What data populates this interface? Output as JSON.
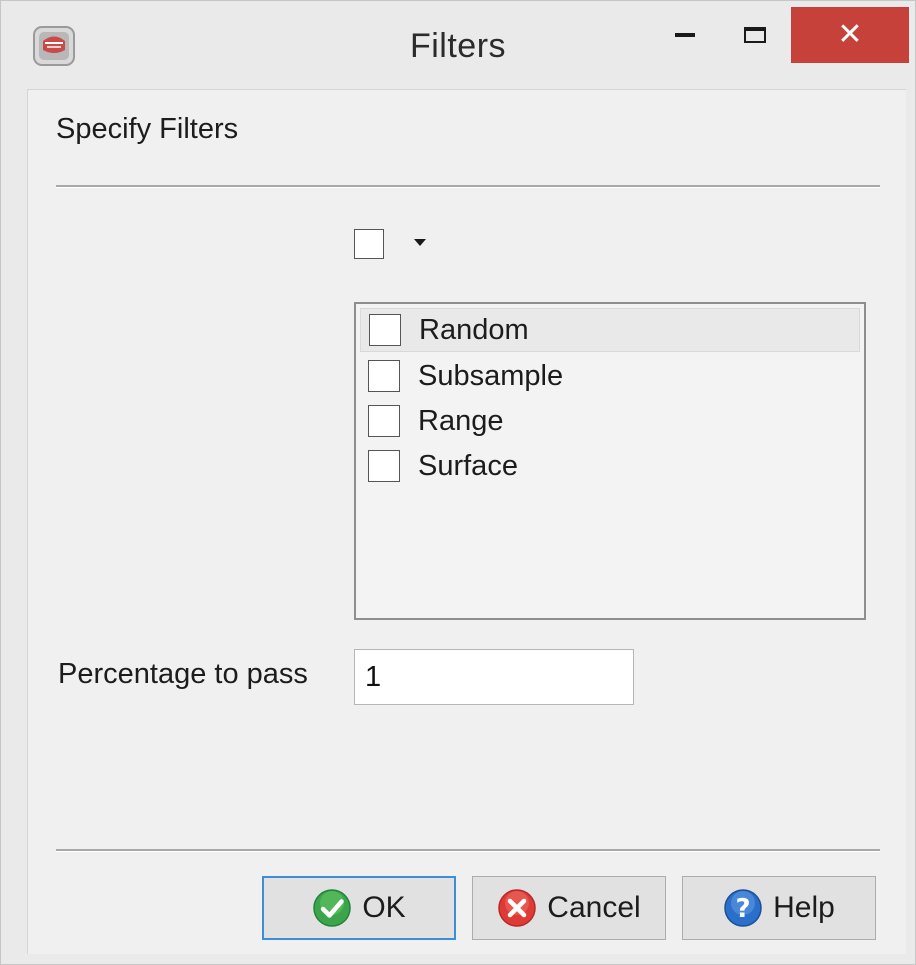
{
  "window": {
    "title": "Filters"
  },
  "dialog": {
    "heading": "Specify Filters",
    "filters": [
      {
        "label": "Random",
        "checked": false,
        "highlighted": true
      },
      {
        "label": "Subsample",
        "checked": false,
        "highlighted": false
      },
      {
        "label": "Range",
        "checked": false,
        "highlighted": false
      },
      {
        "label": "Surface",
        "checked": false,
        "highlighted": false
      }
    ],
    "percentage_label": "Percentage to pass",
    "percentage_value": "1"
  },
  "buttons": {
    "ok": "OK",
    "cancel": "Cancel",
    "help": "Help"
  },
  "colors": {
    "close_button": "#c7413b",
    "default_button_border": "#3c8fd6"
  },
  "icons": {
    "app": "app-icon",
    "ok": "check-circle-icon",
    "cancel": "x-circle-icon",
    "help": "question-circle-icon"
  }
}
